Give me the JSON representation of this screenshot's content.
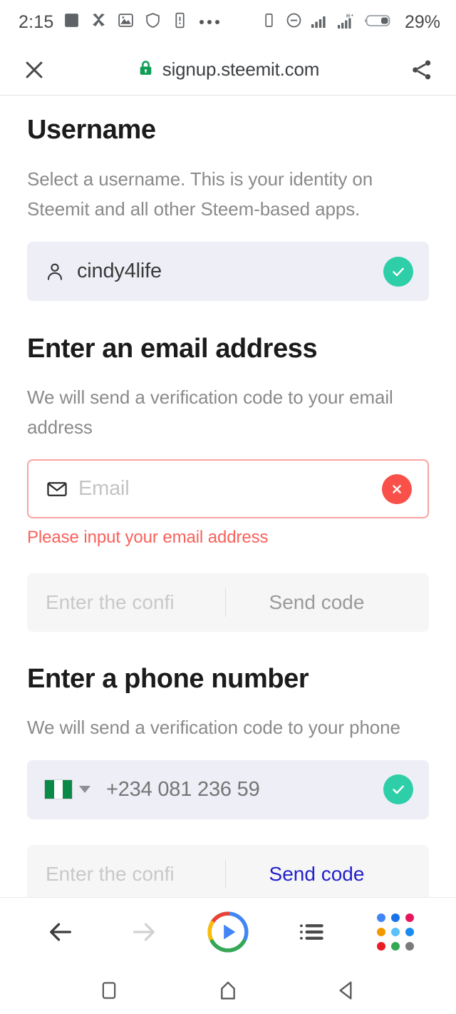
{
  "statusbar": {
    "time": "2:15",
    "battery_percent": "29%",
    "left_icons": [
      "square-badge-icon",
      "x-app-icon",
      "photo-icon",
      "shield-icon",
      "phone-alert-icon",
      "more-dots-icon"
    ],
    "right_icons": [
      "device-icon",
      "dnd-icon",
      "signal-1-icon",
      "signal-2-hplus-icon",
      "battery-icon"
    ],
    "network_label": "H+"
  },
  "browser": {
    "url": "signup.steemit.com",
    "close_label": "Close",
    "share_label": "Share",
    "secure": true
  },
  "sections": {
    "username": {
      "heading": "Username",
      "description": "Select a username. This is your identity on Steemit and all other Steem-based apps.",
      "value": "cindy4life",
      "status": "valid"
    },
    "email": {
      "heading": "Enter an email address",
      "description": "We will send a verification code to your email address",
      "placeholder": "Email",
      "value": "",
      "status": "invalid",
      "error": "Please input your email address",
      "confirm_placeholder": "Enter the confi",
      "send_code_label": "Send code",
      "send_code_enabled": false
    },
    "phone": {
      "heading": "Enter a phone number",
      "description": "We will send a verification code to your phone",
      "country_code_flag": "Nigeria",
      "value": "+234 081 236 59",
      "status": "valid",
      "confirm_placeholder": "Enter the confi",
      "send_code_label": "Send code",
      "send_code_enabled": true
    }
  },
  "browser_bottom_bar": {
    "back_label": "Back",
    "forward_label": "Forward",
    "home_label": "Home",
    "tabs_label": "Tabs",
    "menu_label": "Menu"
  },
  "android_nav": {
    "recents_label": "Recents",
    "home_label": "Home",
    "back_label": "Back"
  },
  "colors": {
    "valid_green": "#2ecfa8",
    "invalid_red": "#f9504a",
    "error_text": "#f9615b",
    "field_bg": "#eeeef7",
    "link_blue": "#2222cc",
    "lock_green": "#0f9d58",
    "flag_green": "#0a8a46"
  }
}
